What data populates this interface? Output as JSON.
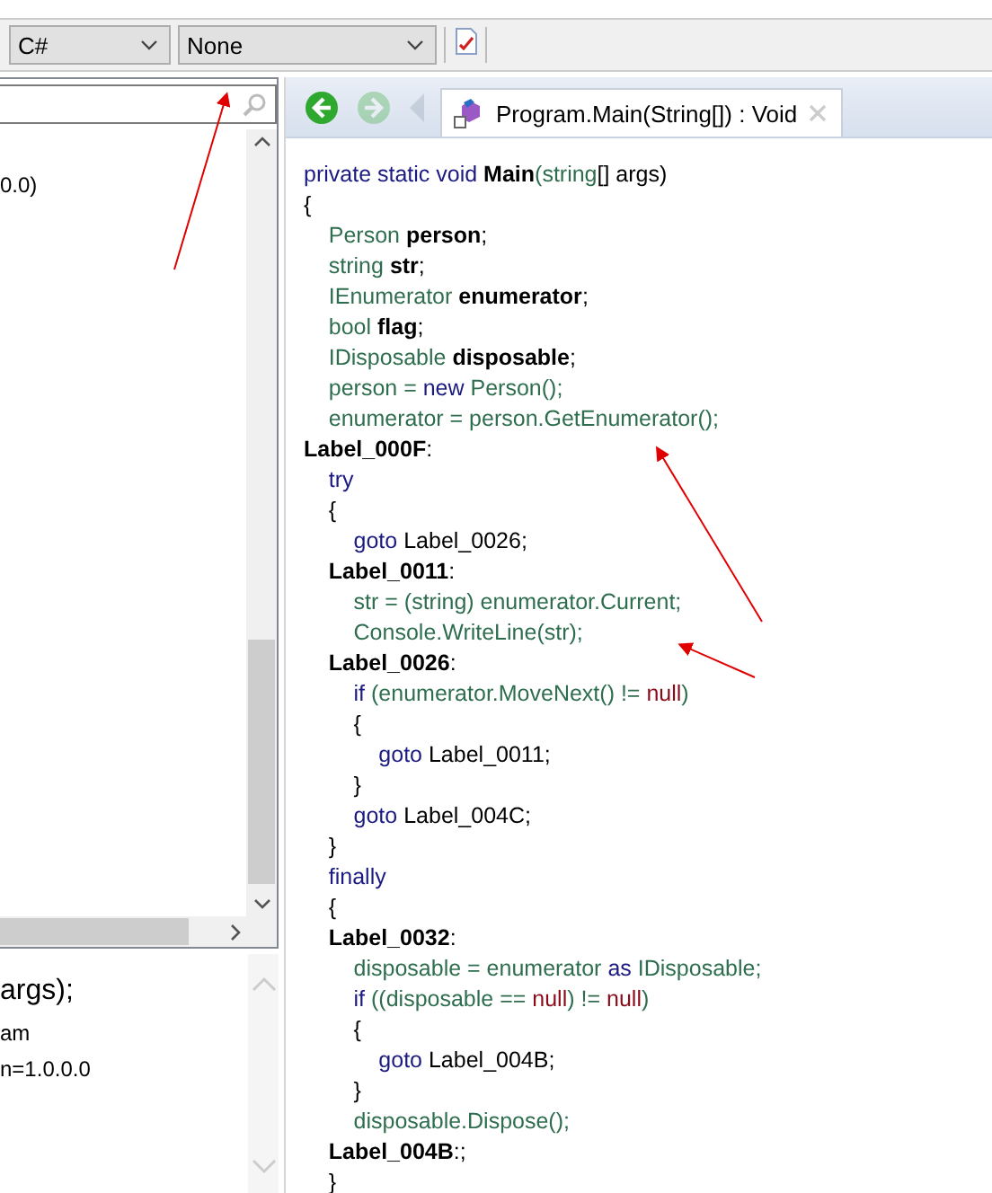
{
  "toolbar": {
    "combos": [
      {
        "value": "C#"
      },
      {
        "value": "None"
      }
    ]
  },
  "tree": {
    "items": [
      "0.0)"
    ]
  },
  "detail": {
    "lines": [
      {
        "kind": "signature",
        "text": "args);"
      },
      {
        "kind": "info",
        "text": "am"
      },
      {
        "kind": "info",
        "text": "n=1.0.0.0"
      }
    ]
  },
  "editor": {
    "nav": [
      {
        "kind": "back",
        "disabled": false
      },
      {
        "kind": "forward",
        "disabled": true
      },
      {
        "kind": "history",
        "disabled": true
      }
    ],
    "tabs": [
      {
        "label": "Program.Main(String[]) : Void",
        "selected": true
      }
    ],
    "lines": [
      [
        {
          "kind": "keyword",
          "text": "private static void "
        },
        {
          "kind": "bold",
          "text": "Main"
        },
        {
          "kind": "type",
          "text": "(string"
        },
        {
          "kind": "plain",
          "text": "[] args)"
        }
      ],
      [
        {
          "kind": "plain",
          "text": "{"
        }
      ],
      [
        {
          "kind": "type",
          "text": "    Person "
        },
        {
          "kind": "bold",
          "text": "person"
        },
        {
          "kind": "plain",
          "text": ";"
        }
      ],
      [
        {
          "kind": "type",
          "text": "    string "
        },
        {
          "kind": "bold",
          "text": "str"
        },
        {
          "kind": "plain",
          "text": ";"
        }
      ],
      [
        {
          "kind": "type",
          "text": "    IEnumerator "
        },
        {
          "kind": "bold",
          "text": "enumerator"
        },
        {
          "kind": "plain",
          "text": ";"
        }
      ],
      [
        {
          "kind": "type",
          "text": "    bool "
        },
        {
          "kind": "bold",
          "text": "flag"
        },
        {
          "kind": "plain",
          "text": ";"
        }
      ],
      [
        {
          "kind": "type",
          "text": "    IDisposable "
        },
        {
          "kind": "bold",
          "text": "disposable"
        },
        {
          "kind": "plain",
          "text": ";"
        }
      ],
      [
        {
          "kind": "type",
          "text": "    person = "
        },
        {
          "kind": "keyword",
          "text": "new "
        },
        {
          "kind": "type",
          "text": "Person();"
        }
      ],
      [
        {
          "kind": "type",
          "text": "    enumerator = person.GetEnumerator();"
        }
      ],
      [
        {
          "kind": "bold",
          "text": "Label_000F"
        },
        {
          "kind": "plain",
          "text": ":"
        }
      ],
      [
        {
          "kind": "keyword",
          "text": "    try"
        }
      ],
      [
        {
          "kind": "plain",
          "text": "    {"
        }
      ],
      [
        {
          "kind": "keyword",
          "text": "        goto "
        },
        {
          "kind": "plain",
          "text": "Label_0026;"
        }
      ],
      [
        {
          "kind": "bold",
          "text": "    Label_0011"
        },
        {
          "kind": "plain",
          "text": ":"
        }
      ],
      [
        {
          "kind": "type",
          "text": "        str = (string) enumerator.Current;"
        }
      ],
      [
        {
          "kind": "type",
          "text": "        Console.WriteLine(str);"
        }
      ],
      [
        {
          "kind": "bold",
          "text": "    Label_0026"
        },
        {
          "kind": "plain",
          "text": ":"
        }
      ],
      [
        {
          "kind": "keyword",
          "text": "        if "
        },
        {
          "kind": "type",
          "text": "(enumerator.MoveNext() != "
        },
        {
          "kind": "literal",
          "text": "null"
        },
        {
          "kind": "type",
          "text": ")"
        }
      ],
      [
        {
          "kind": "plain",
          "text": "        {"
        }
      ],
      [
        {
          "kind": "keyword",
          "text": "            goto "
        },
        {
          "kind": "plain",
          "text": "Label_0011;"
        }
      ],
      [
        {
          "kind": "plain",
          "text": "        }"
        }
      ],
      [
        {
          "kind": "keyword",
          "text": "        goto "
        },
        {
          "kind": "plain",
          "text": "Label_004C;"
        }
      ],
      [
        {
          "kind": "plain",
          "text": "    }"
        }
      ],
      [
        {
          "kind": "keyword",
          "text": "    finally"
        }
      ],
      [
        {
          "kind": "plain",
          "text": "    {"
        }
      ],
      [
        {
          "kind": "bold",
          "text": "    Label_0032"
        },
        {
          "kind": "plain",
          "text": ":"
        }
      ],
      [
        {
          "kind": "type",
          "text": "        disposable = enumerator "
        },
        {
          "kind": "keyword",
          "text": "as "
        },
        {
          "kind": "type",
          "text": "IDisposable;"
        }
      ],
      [
        {
          "kind": "keyword",
          "text": "        if "
        },
        {
          "kind": "type",
          "text": "((disposable == "
        },
        {
          "kind": "literal",
          "text": "null"
        },
        {
          "kind": "type",
          "text": ") != "
        },
        {
          "kind": "literal",
          "text": "null"
        },
        {
          "kind": "type",
          "text": ")"
        }
      ],
      [
        {
          "kind": "plain",
          "text": "        {"
        }
      ],
      [
        {
          "kind": "keyword",
          "text": "            goto "
        },
        {
          "kind": "plain",
          "text": "Label_004B;"
        }
      ],
      [
        {
          "kind": "plain",
          "text": "        }"
        }
      ],
      [
        {
          "kind": "type",
          "text": "        disposable.Dispose();"
        }
      ],
      [
        {
          "kind": "bold",
          "text": "    Label_004B"
        },
        {
          "kind": "plain",
          "text": ":;"
        }
      ],
      [
        {
          "kind": "plain",
          "text": "    }"
        }
      ]
    ]
  }
}
